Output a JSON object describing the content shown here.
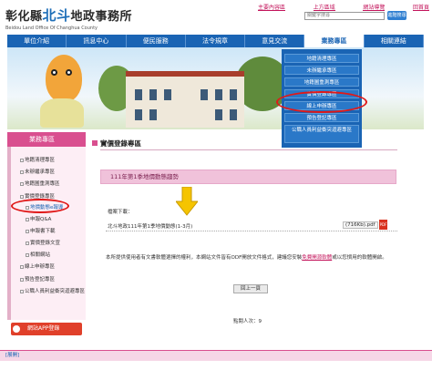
{
  "header": {
    "logo_zh_prefix": "彰化縣",
    "logo_zh_big": "北斗",
    "logo_zh_suffix": "地政事務所",
    "logo_en": "Beidou Land Office Of Changhua County",
    "top_links": [
      "主要內容區",
      "上方區域",
      "網站導覽",
      "回首頁"
    ],
    "search_placeholder": "關鍵字搜尋",
    "search_button": "進階搜尋"
  },
  "nav": {
    "items": [
      "單位介紹",
      "訊息中心",
      "便民服務",
      "法令規章",
      "意見交流",
      "業務專區",
      "相關連結"
    ],
    "active_index": 5
  },
  "dropdown": {
    "items": [
      "地籍清理專區",
      "未辦繼承專區",
      "地籍圖重測專區",
      "實價登錄專區",
      "線上申辦專區",
      "預告登記專區",
      "公職人員利益衝突迴避專區"
    ]
  },
  "sidebar": {
    "title": "業務專區",
    "items": [
      "地籍清理專區",
      "未辦繼承專區",
      "地籍圖重測專區",
      "實價登錄專區",
      "地價動態e報導",
      "申報Q&A",
      "申報書下載",
      "實價登錄文宣",
      "相關網站",
      "線上申辦專區",
      "預告登記專區",
      "公職人員利益衝突迴避專區"
    ],
    "app_button": "網站APP登錄"
  },
  "main": {
    "page_title": "實價登錄專區",
    "doc_title": "111年第1季地價動態趨勢",
    "download_label": "檔案下載：",
    "file_name": "北斗地政111年第1季地價動態(1-3月)",
    "file_size": "(716Kb).pdf",
    "file_type": "PDF",
    "notice_text": "本所提供使用者有文書軟體選擇的權利，本網站文件皆有ODF開放文件格式，建議您安裝",
    "notice_link": "免費開源軟體",
    "notice_text2": "或以您慣用的軟體開啟。",
    "prev_button": "回上一頁",
    "counter": "點閱人次：9"
  },
  "footer": {
    "label": "[展開]"
  },
  "colors": {
    "nav_blue": "#1a64b4",
    "pink": "#d94f8f",
    "highlight_red": "#e01919",
    "arrow_yellow": "#f5c400"
  }
}
